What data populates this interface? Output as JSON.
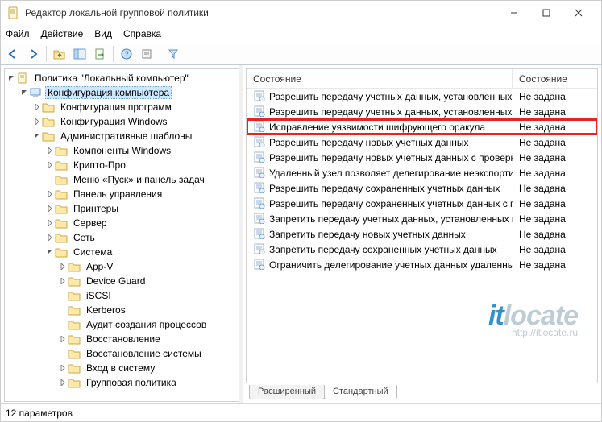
{
  "window": {
    "title": "Редактор локальной групповой политики"
  },
  "menus": [
    "Файл",
    "Действие",
    "Вид",
    "Справка"
  ],
  "toolbar_icons": [
    "back-icon",
    "forward-icon",
    "up-icon",
    "show-hide-tree-icon",
    "export-icon",
    "help-icon",
    "properties-icon",
    "filter-icon"
  ],
  "tree": {
    "root": {
      "label": "Политика \"Локальный компьютер\"",
      "icon": "policy-icon"
    },
    "items": [
      {
        "indent": 1,
        "exp": "open",
        "icon": "computer-icon",
        "label": "Конфигурация компьютера",
        "sel": true
      },
      {
        "indent": 2,
        "exp": "closed",
        "icon": "folder-icon",
        "label": "Конфигурация программ"
      },
      {
        "indent": 2,
        "exp": "closed",
        "icon": "folder-icon",
        "label": "Конфигурация Windows"
      },
      {
        "indent": 2,
        "exp": "open",
        "icon": "folder-icon",
        "label": "Административные шаблоны"
      },
      {
        "indent": 3,
        "exp": "closed",
        "icon": "folder-icon",
        "label": "Компоненты Windows"
      },
      {
        "indent": 3,
        "exp": "closed",
        "icon": "folder-icon",
        "label": "Крипто-Про"
      },
      {
        "indent": 3,
        "exp": "none",
        "icon": "folder-icon",
        "label": "Меню «Пуск» и панель задач"
      },
      {
        "indent": 3,
        "exp": "closed",
        "icon": "folder-icon",
        "label": "Панель управления"
      },
      {
        "indent": 3,
        "exp": "closed",
        "icon": "folder-icon",
        "label": "Принтеры"
      },
      {
        "indent": 3,
        "exp": "closed",
        "icon": "folder-icon",
        "label": "Сервер"
      },
      {
        "indent": 3,
        "exp": "closed",
        "icon": "folder-icon",
        "label": "Сеть"
      },
      {
        "indent": 3,
        "exp": "open",
        "icon": "folder-icon",
        "label": "Система"
      },
      {
        "indent": 4,
        "exp": "closed",
        "icon": "folder-icon",
        "label": "App-V"
      },
      {
        "indent": 4,
        "exp": "closed",
        "icon": "folder-icon",
        "label": "Device Guard"
      },
      {
        "indent": 4,
        "exp": "none",
        "icon": "folder-icon",
        "label": "iSCSI"
      },
      {
        "indent": 4,
        "exp": "none",
        "icon": "folder-icon",
        "label": "Kerberos"
      },
      {
        "indent": 4,
        "exp": "none",
        "icon": "folder-icon",
        "label": "Аудит создания процессов"
      },
      {
        "indent": 4,
        "exp": "closed",
        "icon": "folder-icon",
        "label": "Восстановление"
      },
      {
        "indent": 4,
        "exp": "none",
        "icon": "folder-icon",
        "label": "Восстановление системы"
      },
      {
        "indent": 4,
        "exp": "closed",
        "icon": "folder-icon",
        "label": "Вход в систему"
      },
      {
        "indent": 4,
        "exp": "closed",
        "icon": "folder-icon",
        "label": "Групповая политика"
      }
    ]
  },
  "list_headers": {
    "c0": "Состояние",
    "c1": "Состояние"
  },
  "list": [
    {
      "label": "Разрешить передачу учетных данных, установленных по ...",
      "state": "Не задана"
    },
    {
      "label": "Разрешить передачу учетных данных, установленных по ...",
      "state": "Не задана"
    },
    {
      "label": "Исправление уязвимости шифрующего оракула",
      "state": "Не задана",
      "hl": true
    },
    {
      "label": "Разрешить передачу новых учетных данных",
      "state": "Не задана"
    },
    {
      "label": "Разрешить передачу новых учетных данных с проверкой ...",
      "state": "Не задана"
    },
    {
      "label": "Удаленный узел позволяет делегирование неэкспортиру...",
      "state": "Не задана"
    },
    {
      "label": "Разрешить передачу сохраненных учетных данных",
      "state": "Не задана"
    },
    {
      "label": "Разрешить передачу сохраненных учетных данных с про...",
      "state": "Не задана"
    },
    {
      "label": "Запретить передачу учетных данных, установленных по у...",
      "state": "Не задана"
    },
    {
      "label": "Запретить передачу новых учетных данных",
      "state": "Не задана"
    },
    {
      "label": "Запретить передачу сохраненных учетных данных",
      "state": "Не задана"
    },
    {
      "label": "Ограничить делегирование учетных данных удаленным ...",
      "state": "Не задана"
    }
  ],
  "tabs": {
    "ext": "Расширенный",
    "std": "Стандартный"
  },
  "status": "12 параметров",
  "watermark": {
    "main": "itlocate",
    "sub": "http://itlocate.ru"
  }
}
